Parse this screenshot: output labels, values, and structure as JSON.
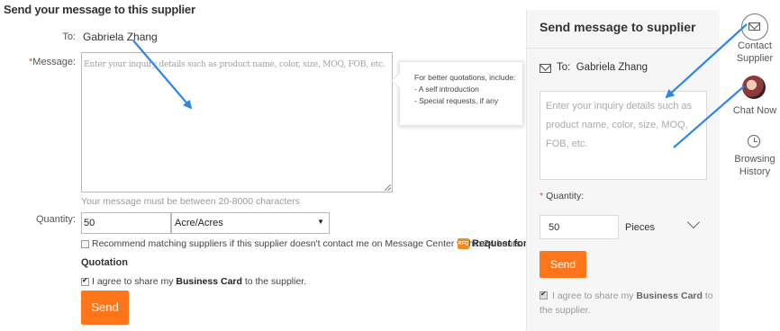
{
  "form": {
    "title": "Send your message to this supplier",
    "to_label": "To:",
    "to_value": "Gabriela Zhang",
    "message_required_mark": "*",
    "message_label": "Message:",
    "message_placeholder": "Enter your inquiry details such as product name, color, size, MOQ, FOB, etc.",
    "tooltip": {
      "title": "For better quotations, include:",
      "items": [
        "- A self introduction",
        "- Special requests, if any"
      ]
    },
    "length_hint": "Your message must be between 20-8000 characters",
    "quantity_label": "Quantity:",
    "quantity_value": "50",
    "unit_value": "Acre/Acres",
    "unit_arrow": "▼",
    "recommend_text": "Recommend matching suppliers if this supplier doesn't contact me on Message Center within 24 hours.",
    "rfq_badge": "RFQ",
    "rfq_link_line1": "Request for",
    "rfq_link_line2": "Quotation",
    "recommend_checked": false,
    "agree_prefix": "I agree to share my ",
    "agree_bold": "Business Card",
    "agree_suffix": " to the supplier.",
    "agree_checked": true,
    "send_label": "Send"
  },
  "panel": {
    "title": "Send message to supplier",
    "to_label": "To:",
    "to_value": "Gabriela Zhang",
    "message_placeholder": "Enter your inquiry details such as product name, color, size, MOQ, FOB, etc.",
    "quantity_required_mark": "*",
    "quantity_label": "Quantity:",
    "quantity_value": "50",
    "unit_value": "Pieces",
    "send_label": "Send",
    "agree_prefix": "I agree to share my ",
    "agree_bold": "Business Card",
    "agree_suffix": " to the supplier.",
    "agree_checked": true
  },
  "toolbar": {
    "contact_line1": "Contact",
    "contact_line2": "Supplier",
    "chat_label": "Chat Now",
    "history_line1": "Browsing",
    "history_line2": "History"
  },
  "colors": {
    "accent": "#ff7519",
    "annotation_arrow": "#2f86e6",
    "required": "#e84b1f"
  }
}
